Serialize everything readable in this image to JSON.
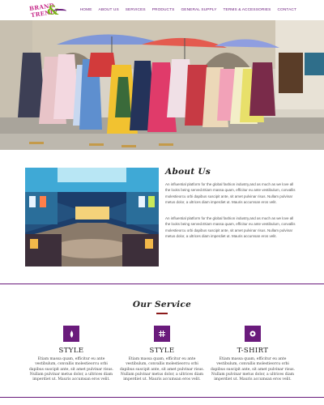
{
  "logo": {
    "line1": "BRAND",
    "amp": "&",
    "line2": "TREND"
  },
  "nav": {
    "items": [
      {
        "label": "HOME"
      },
      {
        "label": "ABOUT US"
      },
      {
        "label": "SERVICES"
      },
      {
        "label": "PRODUCTS"
      },
      {
        "label": "GENERAL SUPPLY"
      },
      {
        "label": "TERMS & ACCESSORIES"
      },
      {
        "label": "CONTACT"
      }
    ]
  },
  "about": {
    "title": "About Us",
    "p1": "An influential platform for the global fashion industry,and as much as we love all the looks being served.Etiam massa quam, efficitur eu ante vestibulum, convallis molestieorcu orbi dapibus suscipit ante, sit amet pulvinar risus. Nullam pulvinar metus dolor, a ultrices diam imperdiet ut. Mauris accumsan eros velit.",
    "p2": "An influential platform for the global fashion industry,and as much as we love all the looks being served.Etiam massa quam, efficitur eu ante vestibulum, convallis molestieorcu orbi dapibus suscipit ante, sit amet pulvinar risus. Nullam pulvinar metus dolor, a ultrices diam imperdiet ut. Mauris accumsan eros velit."
  },
  "services": {
    "title": "Our Service",
    "items": [
      {
        "icon": "drop-icon",
        "name": "STYLE",
        "text": "Etiam massa quam, efficitur eu ante vestibulum, convallis molestieorcu orbi dapibus suscipit ante, sit amet pulvinar risus. Nullam pulvinar metus dolor, a ultrices diam imperdiet ut. Mauris accumsan eros velit."
      },
      {
        "icon": "hashtag-icon",
        "name": "STYLE",
        "text": "Etiam massa quam, efficitur eu ante vestibulum, convallis molestieorcu orbi dapibus suscipit ante, sit amet pulvinar risus. Nullam pulvinar metus dolor, a ultrices diam imperdiet ut. Mauris accumsan eros velit."
      },
      {
        "icon": "circle-dot-icon",
        "name": "T-SHIRT",
        "text": "Etiam massa quam, efficitur eu ante vestibulum, convallis molestieorcu orbi dapibus suscipit ante, sit amet pulvinar risus. Nullam pulvinar metus dolor, a ultrices diam imperdiet ut. Mauris accumsan eros velit."
      }
    ]
  },
  "colors": {
    "brand": "#6a1b7c",
    "logo_pink": "#c72a8a",
    "logo_green": "#7ab317",
    "accent_red": "#8b1a1a"
  }
}
